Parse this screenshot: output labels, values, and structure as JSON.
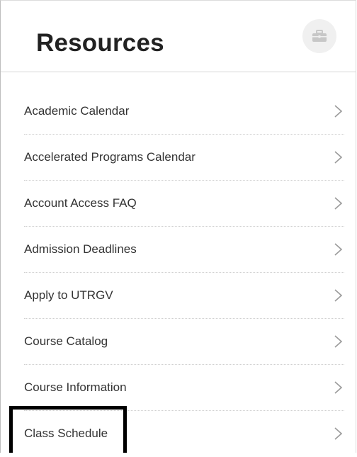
{
  "header": {
    "title": "Resources",
    "icon": "briefcase-icon"
  },
  "resources": {
    "items": [
      {
        "label": "Academic Calendar"
      },
      {
        "label": "Accelerated Programs Calendar"
      },
      {
        "label": "Account Access FAQ"
      },
      {
        "label": "Admission Deadlines"
      },
      {
        "label": "Apply to UTRGV"
      },
      {
        "label": "Course Catalog"
      },
      {
        "label": "Course Information"
      },
      {
        "label": "Class Schedule",
        "highlighted": true
      }
    ],
    "chevron_icon": "chevron-right-icon"
  },
  "colors": {
    "title": "#222222",
    "text": "#333333",
    "chevron": "#9a9a9a",
    "icon_bg": "#f0f0f0",
    "highlight_border": "#000000"
  }
}
